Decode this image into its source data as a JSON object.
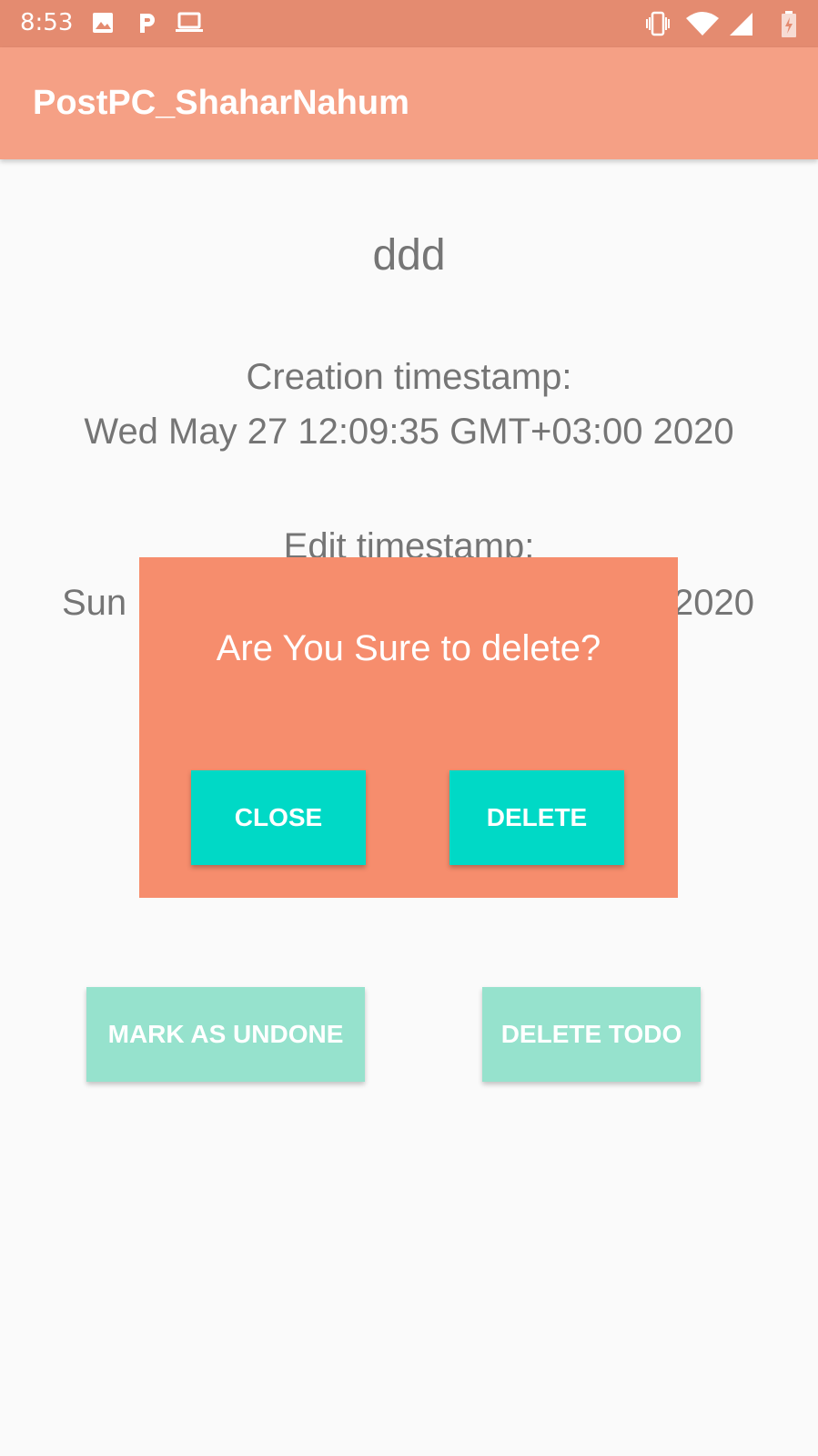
{
  "status_bar": {
    "time": "8:53",
    "left_icons": [
      "image-icon",
      "p-app-icon",
      "laptop-icon"
    ],
    "right_icons": [
      "vibrate-icon",
      "wifi-icon",
      "signal-icon",
      "battery-charging-icon"
    ]
  },
  "app_bar": {
    "title": "PostPC_ShaharNahum"
  },
  "todo": {
    "title": "ddd",
    "creation_label": "Creation timestamp:",
    "creation_value": "Wed May 27 12:09:35 GMT+03:00 2020",
    "edit_label": "Edit timestamp:",
    "edit_value_start": "Sun",
    "edit_value_end": "2020"
  },
  "actions": {
    "mark_undone_label": "MARK AS UNDONE",
    "delete_todo_label": "DELETE TODO"
  },
  "dialog": {
    "message": "Are You Sure to delete?",
    "close_label": "CLOSE",
    "delete_label": "DELETE"
  },
  "colors": {
    "status_bar": "#e48b70",
    "app_bar": "#f5a085",
    "dialog_bg": "#f68d6d",
    "dialog_button": "#00d9c6",
    "action_button": "#96e2cd"
  }
}
